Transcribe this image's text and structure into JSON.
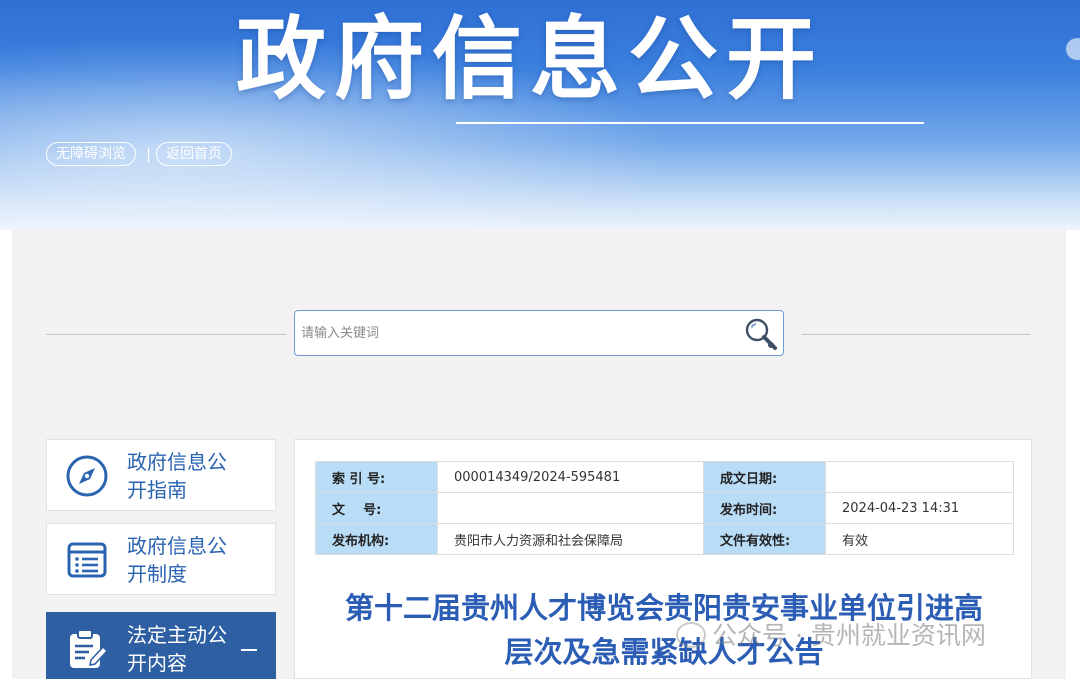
{
  "banner": {
    "title": "政府信息公开",
    "links": {
      "accessible": "无障碍浏览",
      "separator": "|",
      "home": "返回首页"
    }
  },
  "search": {
    "placeholder": "请输入关键词"
  },
  "sidebar": {
    "items": [
      {
        "label": "政府信息公开指南",
        "icon": "compass-icon",
        "active": false
      },
      {
        "label": "政府信息公开制度",
        "icon": "list-document-icon",
        "active": false
      },
      {
        "label": "法定主动公开内容",
        "icon": "clipboard-edit-icon",
        "active": true,
        "expand_icon": "minus-icon"
      }
    ]
  },
  "meta": {
    "rows": [
      {
        "k1": "索 引 号:",
        "v1": "000014349/2024-595481",
        "k2": "成文日期:",
        "v2": ""
      },
      {
        "k1": "文    号:",
        "v1": "",
        "k2": "发布时间:",
        "v2": "2024-04-23 14:31"
      },
      {
        "k1": "发布机构:",
        "v1": "贵阳市人力资源和社会保障局",
        "k2": "文件有效性:",
        "v2": "有效"
      }
    ]
  },
  "article": {
    "title_line1": "第十二届贵州人才博览会贵阳贵安事业单位引进高",
    "title_line2": "层次及急需紧缺人才公告"
  },
  "watermark": {
    "text": "公众号 · 贵州就业资讯网"
  },
  "colors": {
    "banner_blue": "#3b80de",
    "accent_blue": "#2b5db5",
    "active_sidebar": "#2e5fa3",
    "table_key_bg": "#b9dcf7",
    "panel_bg": "#f2f2f2"
  }
}
